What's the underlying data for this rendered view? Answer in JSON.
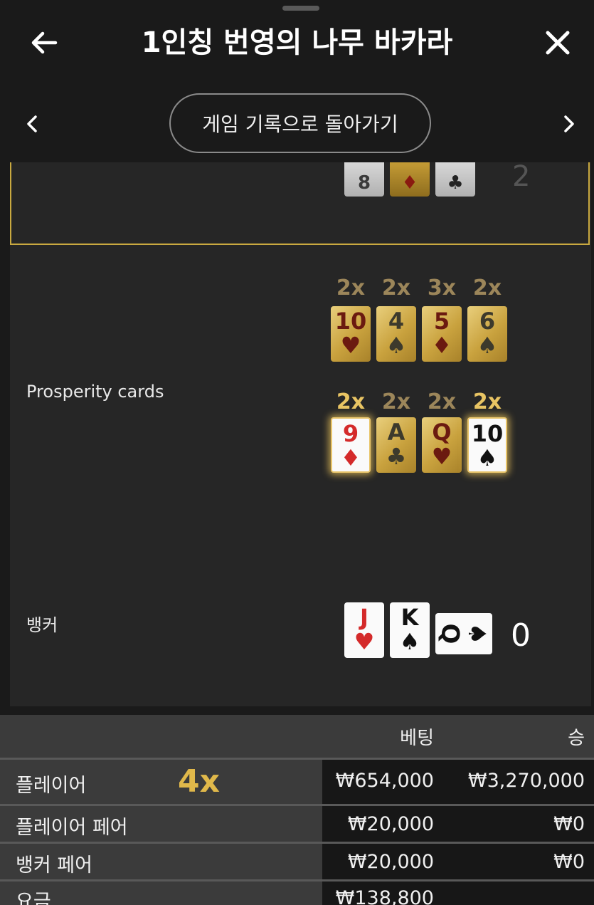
{
  "header": {
    "title": "1인칭 번영의 나무 바카라",
    "back_icon": "arrow-left-icon",
    "close_icon": "close-icon"
  },
  "nav": {
    "history_button": "게임 기록으로 돌아가기",
    "prev_icon": "chevron-left-icon",
    "next_icon": "chevron-right-icon"
  },
  "previous_hand": {
    "total": "2"
  },
  "prosperity": {
    "label": "Prosperity cards",
    "row1": [
      {
        "mult": "2x",
        "rank": "10",
        "suit": "♥",
        "highlight": false
      },
      {
        "mult": "2x",
        "rank": "4",
        "suit": "♠",
        "highlight": false
      },
      {
        "mult": "3x",
        "rank": "5",
        "suit": "♦",
        "highlight": false
      },
      {
        "mult": "2x",
        "rank": "6",
        "suit": "♠",
        "highlight": false
      }
    ],
    "row2": [
      {
        "mult": "2x",
        "rank": "9",
        "suit": "♦",
        "highlight": true
      },
      {
        "mult": "2x",
        "rank": "A",
        "suit": "♣",
        "highlight": false
      },
      {
        "mult": "2x",
        "rank": "Q",
        "suit": "♥",
        "highlight": false
      },
      {
        "mult": "2x",
        "rank": "10",
        "suit": "♠",
        "highlight": true
      }
    ]
  },
  "banker": {
    "label": "뱅커",
    "cards": [
      {
        "rank": "J",
        "suit": "♥"
      },
      {
        "rank": "K",
        "suit": "♠"
      },
      {
        "rank": "Q",
        "suit": "♠"
      }
    ],
    "total": "0"
  },
  "bets_table": {
    "headers": {
      "bet": "베팅",
      "win": "승"
    },
    "rows": [
      {
        "name": "플레이어",
        "multiplier": "4x",
        "bet": "₩654,000",
        "win": "₩3,270,000"
      },
      {
        "name": "플레이어 페어",
        "multiplier": "",
        "bet": "₩20,000",
        "win": "₩0"
      },
      {
        "name": "뱅커 페어",
        "multiplier": "",
        "bet": "₩20,000",
        "win": "₩0"
      },
      {
        "name": "요금",
        "multiplier": "",
        "bet": "₩138,800",
        "win": ""
      }
    ]
  }
}
